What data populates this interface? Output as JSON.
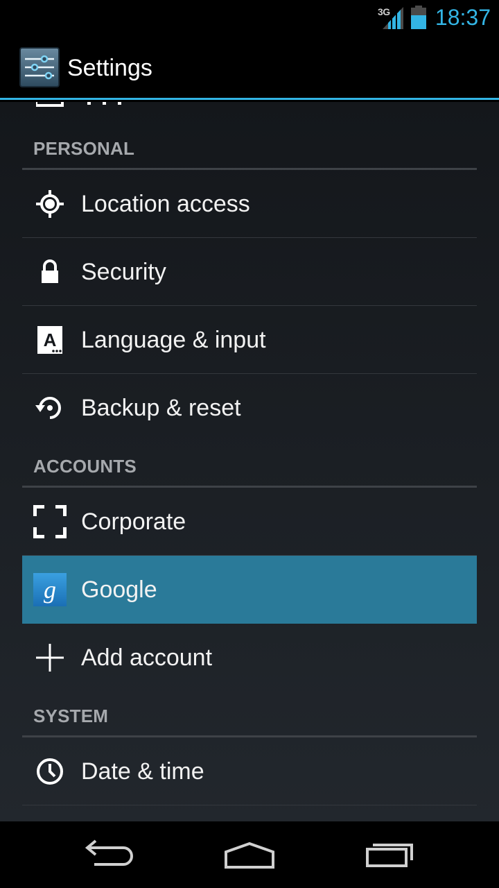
{
  "status_bar": {
    "network_type": "3G",
    "time": "18:37",
    "icons": [
      "signal-icon",
      "battery-icon"
    ]
  },
  "action_bar": {
    "title": "Settings",
    "icon": "settings-sliders-icon"
  },
  "sections": {
    "personal": {
      "header": "PERSONAL",
      "items": [
        {
          "label": "Location access",
          "icon": "location-icon"
        },
        {
          "label": "Security",
          "icon": "lock-icon"
        },
        {
          "label": "Language & input",
          "icon": "keyboard-a-icon"
        },
        {
          "label": "Backup & reset",
          "icon": "backup-restore-icon"
        }
      ]
    },
    "accounts": {
      "header": "ACCOUNTS",
      "items": [
        {
          "label": "Corporate",
          "icon": "corporate-icon"
        },
        {
          "label": "Google",
          "icon": "google-icon",
          "selected": true
        },
        {
          "label": "Add account",
          "icon": "plus-icon"
        }
      ]
    },
    "system": {
      "header": "SYSTEM",
      "items": [
        {
          "label": "Date & time",
          "icon": "clock-icon"
        }
      ]
    }
  },
  "nav_bar": {
    "buttons": [
      "back-icon",
      "home-icon",
      "recent-apps-icon"
    ]
  },
  "colors": {
    "accent": "#33b5e5",
    "selected_row": "#2a7a99",
    "section_header_text": "#a6a9ad"
  }
}
